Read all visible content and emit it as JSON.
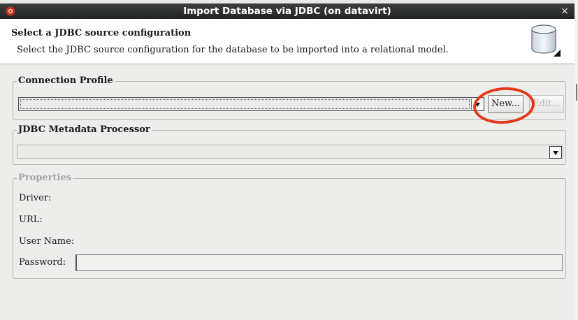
{
  "window": {
    "title": "Import Database via JDBC  (on datavirt)",
    "close_glyph": "×"
  },
  "banner": {
    "title": "Select a JDBC source configuration",
    "description": "Select the JDBC source configuration for the database to be imported into a relational model."
  },
  "connection_profile": {
    "group_label": "Connection Profile",
    "selected_value": "",
    "new_button": "New...",
    "edit_button": "Edit..."
  },
  "metadata_processor": {
    "group_label": "JDBC Metadata Processor",
    "selected_value": ""
  },
  "properties": {
    "group_label": "Properties",
    "driver_label": "Driver:",
    "url_label": "URL:",
    "user_label": "User Name:",
    "password_label": "Password:",
    "password_value": ""
  },
  "colors": {
    "title_bar": "#2e3031",
    "highlight": "#e33a1c",
    "dialog_bg": "#ededeb"
  }
}
